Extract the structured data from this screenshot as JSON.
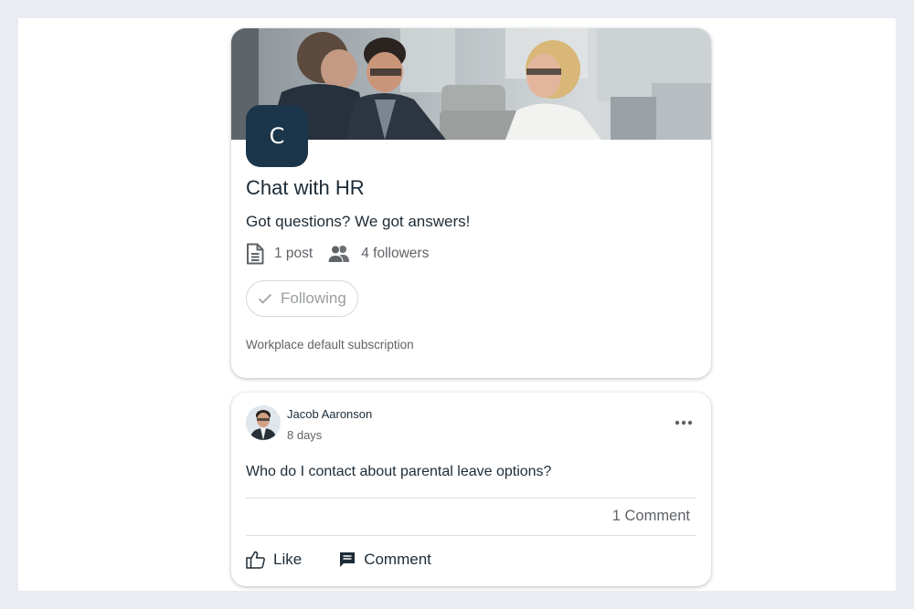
{
  "group": {
    "avatar_letter": "C",
    "title": "Chat with HR",
    "description": "Got questions? We got answers!",
    "posts_count": "1 post",
    "followers_count": "4 followers",
    "following_label": "Following",
    "subscription_note": "Workplace default subscription"
  },
  "post": {
    "author_name": "Jacob Aaronson",
    "time": "8 days",
    "body": "Who do I contact about parental leave options?",
    "comment_count": "1 Comment",
    "like_label": "Like",
    "comment_label": "Comment"
  },
  "icons": {
    "posts": "document-icon",
    "followers": "people-icon",
    "following": "check-icon",
    "more": "more-horizontal-icon",
    "like": "thumbs-up-icon",
    "comment": "comment-bubble-icon"
  },
  "colors": {
    "page_background": "#ebecf1",
    "avatar_background": "#1b364a",
    "text_primary": "#1d2b36",
    "text_secondary": "#5f6367"
  }
}
